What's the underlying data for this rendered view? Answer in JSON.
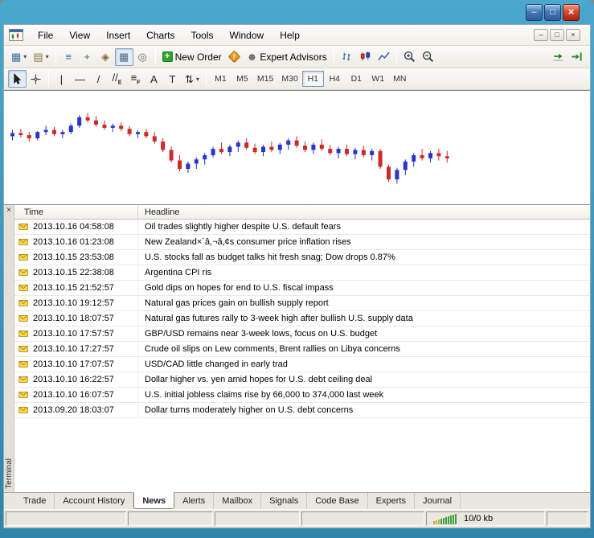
{
  "icons": {
    "dropdown": "▾",
    "plus": "+"
  },
  "titlebar": {
    "buttons": [
      {
        "name": "window-minimize-button",
        "glyph": "–"
      },
      {
        "name": "window-restore-button",
        "glyph": "□"
      },
      {
        "name": "window-close-button",
        "glyph": "×",
        "close": true
      }
    ]
  },
  "menubar": {
    "items": [
      "File",
      "View",
      "Insert",
      "Charts",
      "Tools",
      "Window",
      "Help"
    ],
    "mdi": [
      {
        "name": "mdi-minimize-button",
        "glyph": "–"
      },
      {
        "name": "mdi-restore-button",
        "glyph": "□"
      },
      {
        "name": "mdi-close-button",
        "glyph": "×"
      }
    ]
  },
  "toolbar_standard": [
    {
      "t": "btn",
      "name": "new-chart-button",
      "icon": "new-chart-icon",
      "glyph": "▦",
      "color": "#3A6EA5",
      "dropdown": true
    },
    {
      "t": "btn",
      "name": "profiles-button",
      "icon": "profiles-icon",
      "glyph": "▤",
      "color": "#8A7340",
      "dropdown": true
    },
    {
      "t": "sep"
    },
    {
      "t": "btn",
      "name": "market-watch-button",
      "icon": "market-watch-icon",
      "glyph": "≡",
      "color": "#2A6A9A"
    },
    {
      "t": "btn",
      "name": "data-window-button",
      "icon": "data-window-icon",
      "glyph": "+",
      "color": "#3A7A3A"
    },
    {
      "t": "btn",
      "name": "navigator-button",
      "icon": "navigator-icon",
      "glyph": "◈",
      "color": "#8A6A2A"
    },
    {
      "t": "btn",
      "name": "terminal-button",
      "icon": "terminal-icon",
      "glyph": "▦",
      "color": "#4A6A8A",
      "pressed": true
    },
    {
      "t": "btn",
      "name": "strategy-tester-button",
      "icon": "strategy-tester-icon",
      "glyph": "◎",
      "color": "#6A6A6A"
    },
    {
      "t": "sep"
    },
    {
      "t": "btn",
      "name": "new-order-button",
      "icon": "new-order-plus-icon",
      "plus": true,
      "label": "New Order"
    },
    {
      "t": "btn",
      "name": "metaeditor-button",
      "icon": "metaeditor-icon",
      "diamond": true,
      "glyph": "!"
    },
    {
      "t": "btn",
      "name": "expert-advisors-button",
      "icon": "expert-advisors-icon",
      "glyph": "☻",
      "color": "#6A6A6A",
      "label": "Expert Advisors"
    },
    {
      "t": "sep"
    },
    {
      "t": "btn",
      "name": "bar-chart-button",
      "icon": "bar-chart-icon",
      "svg": "bars"
    },
    {
      "t": "btn",
      "name": "candlestick-chart-button",
      "icon": "candlestick-icon",
      "svg": "candles"
    },
    {
      "t": "btn",
      "name": "line-chart-button",
      "icon": "line-chart-icon",
      "svg": "line"
    },
    {
      "t": "sep"
    },
    {
      "t": "btn",
      "name": "zoom-in-button",
      "icon": "zoom-in-icon",
      "svg": "zoomin"
    },
    {
      "t": "btn",
      "name": "zoom-out-button",
      "icon": "zoom-out-icon",
      "svg": "zoomout"
    },
    {
      "t": "spacer"
    },
    {
      "t": "btn",
      "name": "auto-scroll-button",
      "icon": "auto-scroll-icon",
      "svg": "autoscroll"
    },
    {
      "t": "btn",
      "name": "chart-shift-button",
      "icon": "chart-shift-icon",
      "svg": "chartshift"
    }
  ],
  "toolbar_tools": [
    {
      "t": "btn",
      "name": "cursor-button",
      "icon": "cursor-icon",
      "svg": "pointer",
      "pressed": true
    },
    {
      "t": "btn",
      "name": "crosshair-button",
      "icon": "crosshair-icon",
      "svg": "crosshair"
    },
    {
      "t": "sep"
    },
    {
      "t": "btn",
      "name": "vertical-line-button",
      "icon": "vertical-line-icon",
      "glyph": "|",
      "color": "#222"
    },
    {
      "t": "btn",
      "name": "horizontal-line-button",
      "icon": "horizontal-line-icon",
      "glyph": "—",
      "color": "#222"
    },
    {
      "t": "btn",
      "name": "trendline-button",
      "icon": "trendline-icon",
      "glyph": "/",
      "color": "#222"
    },
    {
      "t": "btn",
      "name": "channel-button",
      "icon": "equidistant-channel-icon",
      "glyph": "//",
      "sub": "E",
      "color": "#222"
    },
    {
      "t": "btn",
      "name": "fibonacci-button",
      "icon": "fibonacci-icon",
      "glyph": "≡",
      "sub": "F",
      "color": "#222"
    },
    {
      "t": "btn",
      "name": "text-button",
      "icon": "text-icon",
      "glyph": "A",
      "color": "#222"
    },
    {
      "t": "btn",
      "name": "text-label-button",
      "icon": "text-label-icon",
      "glyph": "T",
      "color": "#222"
    },
    {
      "t": "btn",
      "name": "arrows-button",
      "icon": "arrows-icon",
      "glyph": "⇅",
      "color": "#222",
      "dropdown": true
    },
    {
      "t": "sep"
    }
  ],
  "timeframes": {
    "items": [
      "M1",
      "M5",
      "M15",
      "M30",
      "H1",
      "H4",
      "D1",
      "W1",
      "MN"
    ],
    "active": "H1"
  },
  "chart": {
    "type": "candlestick",
    "bull_color": "#2834CC",
    "bear_color": "#CC2A2A",
    "candles": [
      [
        60,
        66,
        56,
        63
      ],
      [
        63,
        67,
        59,
        61
      ],
      [
        61,
        64,
        55,
        58
      ],
      [
        58,
        65,
        56,
        64
      ],
      [
        64,
        70,
        61,
        66
      ],
      [
        66,
        69,
        60,
        62
      ],
      [
        62,
        66,
        58,
        64
      ],
      [
        64,
        72,
        62,
        70
      ],
      [
        70,
        80,
        68,
        78
      ],
      [
        78,
        82,
        73,
        75
      ],
      [
        75,
        79,
        69,
        71
      ],
      [
        71,
        75,
        66,
        68
      ],
      [
        68,
        72,
        64,
        70
      ],
      [
        70,
        73,
        65,
        67
      ],
      [
        67,
        70,
        60,
        62
      ],
      [
        62,
        66,
        58,
        64
      ],
      [
        64,
        67,
        58,
        60
      ],
      [
        60,
        64,
        53,
        55
      ],
      [
        55,
        58,
        45,
        47
      ],
      [
        47,
        50,
        35,
        37
      ],
      [
        37,
        42,
        27,
        29
      ],
      [
        29,
        36,
        25,
        34
      ],
      [
        34,
        40,
        29,
        38
      ],
      [
        38,
        44,
        33,
        42
      ],
      [
        42,
        50,
        40,
        48
      ],
      [
        48,
        54,
        43,
        45
      ],
      [
        45,
        52,
        41,
        50
      ],
      [
        50,
        56,
        45,
        54
      ],
      [
        54,
        58,
        47,
        49
      ],
      [
        49,
        53,
        43,
        45
      ],
      [
        45,
        52,
        41,
        50
      ],
      [
        50,
        55,
        45,
        47
      ],
      [
        47,
        54,
        43,
        52
      ],
      [
        52,
        58,
        47,
        56
      ],
      [
        56,
        60,
        49,
        51
      ],
      [
        51,
        55,
        45,
        47
      ],
      [
        47,
        54,
        43,
        52
      ],
      [
        52,
        57,
        46,
        48
      ],
      [
        48,
        52,
        42,
        44
      ],
      [
        44,
        50,
        39,
        48
      ],
      [
        48,
        52,
        41,
        43
      ],
      [
        43,
        49,
        38,
        47
      ],
      [
        47,
        51,
        40,
        42
      ],
      [
        42,
        48,
        37,
        46
      ],
      [
        46,
        48,
        29,
        31
      ],
      [
        31,
        33,
        17,
        19
      ],
      [
        19,
        30,
        15,
        28
      ],
      [
        28,
        38,
        23,
        36
      ],
      [
        36,
        44,
        31,
        42
      ],
      [
        42,
        48,
        37,
        39
      ],
      [
        39,
        46,
        35,
        44
      ],
      [
        44,
        48,
        37,
        41
      ],
      [
        41,
        46,
        35,
        39
      ]
    ]
  },
  "terminal": {
    "close_glyph": "×",
    "vertical_label": "Terminal",
    "columns": [
      "Time",
      "Headline"
    ],
    "rows": [
      {
        "time": "2013.10.16 04:58:08",
        "headline": "Oil trades slightly higher despite U.S. default fears"
      },
      {
        "time": "2013.10.16 01:23:08",
        "headline": "New Zealand×´â,¬â,¢s consumer price inflation rises"
      },
      {
        "time": "2013.10.15 23:53:08",
        "headline": "U.S. stocks fall as budget talks hit fresh snag; Dow drops 0.87%"
      },
      {
        "time": "2013.10.15 22:38:08",
        "headline": "Argentina CPI ris"
      },
      {
        "time": "2013.10.15 21:52:57",
        "headline": "Gold dips on hopes for end to U.S. fiscal impass"
      },
      {
        "time": "2013.10.10 19:12:57",
        "headline": "Natural gas prices gain on bullish supply report"
      },
      {
        "time": "2013.10.10 18:07:57",
        "headline": "Natural gas futures rally to 3-week high after bullish U.S. supply data"
      },
      {
        "time": "2013.10.10 17:57:57",
        "headline": "GBP/USD remains near 3-week lows, focus on U.S. budget"
      },
      {
        "time": "2013.10.10 17:27:57",
        "headline": "Crude oil slips on Lew comments, Brent rallies on Libya concerns"
      },
      {
        "time": "2013.10.10 17:07:57",
        "headline": "USD/CAD little changed in early trad"
      },
      {
        "time": "2013.10.10 16:22:57",
        "headline": "Dollar higher vs. yen amid hopes for U.S. debt ceiling deal"
      },
      {
        "time": "2013.10.10 16:07:57",
        "headline": "U.S. initial jobless claims rise by 66,000 to 374,000 last week"
      },
      {
        "time": "2013.09.20 18:03:07",
        "headline": "Dollar turns moderately higher on U.S. debt concerns"
      }
    ]
  },
  "tabs": {
    "items": [
      "Trade",
      "Account History",
      "News",
      "Alerts",
      "Mailbox",
      "Signals",
      "Code Base",
      "Experts",
      "Journal"
    ],
    "active": "News"
  },
  "statusbar": {
    "kb": "10/0 kb"
  }
}
